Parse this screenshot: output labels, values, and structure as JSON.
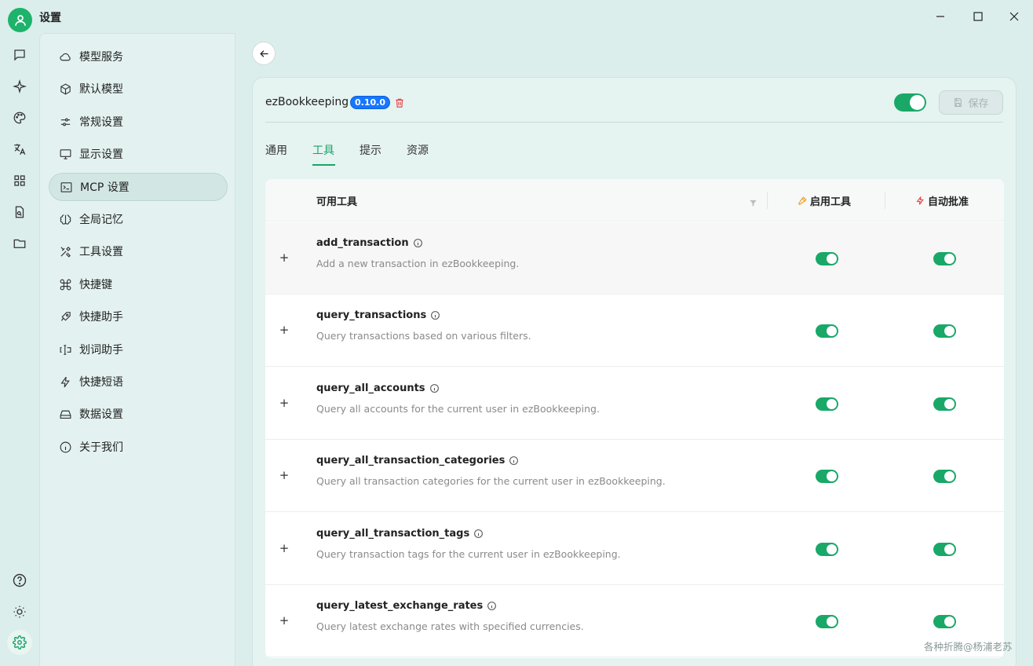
{
  "window": {
    "title": "设置"
  },
  "sidebar": {
    "items": [
      {
        "label": "模型服务",
        "icon": "cloud-icon"
      },
      {
        "label": "默认模型",
        "icon": "cube-icon"
      },
      {
        "label": "常规设置",
        "icon": "sliders-icon"
      },
      {
        "label": "显示设置",
        "icon": "monitor-icon"
      },
      {
        "label": "MCP 设置",
        "icon": "terminal-icon",
        "active": true
      },
      {
        "label": "全局记忆",
        "icon": "brain-icon"
      },
      {
        "label": "工具设置",
        "icon": "tools-icon"
      },
      {
        "label": "快捷键",
        "icon": "command-icon"
      },
      {
        "label": "快捷助手",
        "icon": "rocket-icon"
      },
      {
        "label": "划词助手",
        "icon": "text-cursor-icon"
      },
      {
        "label": "快捷短语",
        "icon": "zap-icon"
      },
      {
        "label": "数据设置",
        "icon": "drive-icon"
      },
      {
        "label": "关于我们",
        "icon": "info-icon"
      }
    ]
  },
  "server": {
    "name": "ezBookkeeping",
    "version": "0.10.0",
    "enabled": true,
    "save_label": "保存"
  },
  "tabs": [
    {
      "label": "通用"
    },
    {
      "label": "工具",
      "active": true
    },
    {
      "label": "提示"
    },
    {
      "label": "资源"
    }
  ],
  "table": {
    "col_tools": "可用工具",
    "col_enable": "启用工具",
    "col_auto": "自动批准",
    "rows": [
      {
        "name": "add_transaction",
        "desc": "Add a new transaction in ezBookkeeping.",
        "enabled": true,
        "auto": true
      },
      {
        "name": "query_transactions",
        "desc": "Query transactions based on various filters.",
        "enabled": true,
        "auto": true
      },
      {
        "name": "query_all_accounts",
        "desc": "Query all accounts for the current user in ezBookkeeping.",
        "enabled": true,
        "auto": true
      },
      {
        "name": "query_all_transaction_categories",
        "desc": "Query all transaction categories for the current user in ezBookkeeping.",
        "enabled": true,
        "auto": true
      },
      {
        "name": "query_all_transaction_tags",
        "desc": "Query transaction tags for the current user in ezBookkeeping.",
        "enabled": true,
        "auto": true
      },
      {
        "name": "query_latest_exchange_rates",
        "desc": "Query latest exchange rates with specified currencies.",
        "enabled": true,
        "auto": true
      }
    ]
  },
  "watermark": "各种折腾@杨浦老苏",
  "colors": {
    "accent": "#19a868",
    "version_badge": "#1677ff",
    "danger": "#e5484d"
  }
}
